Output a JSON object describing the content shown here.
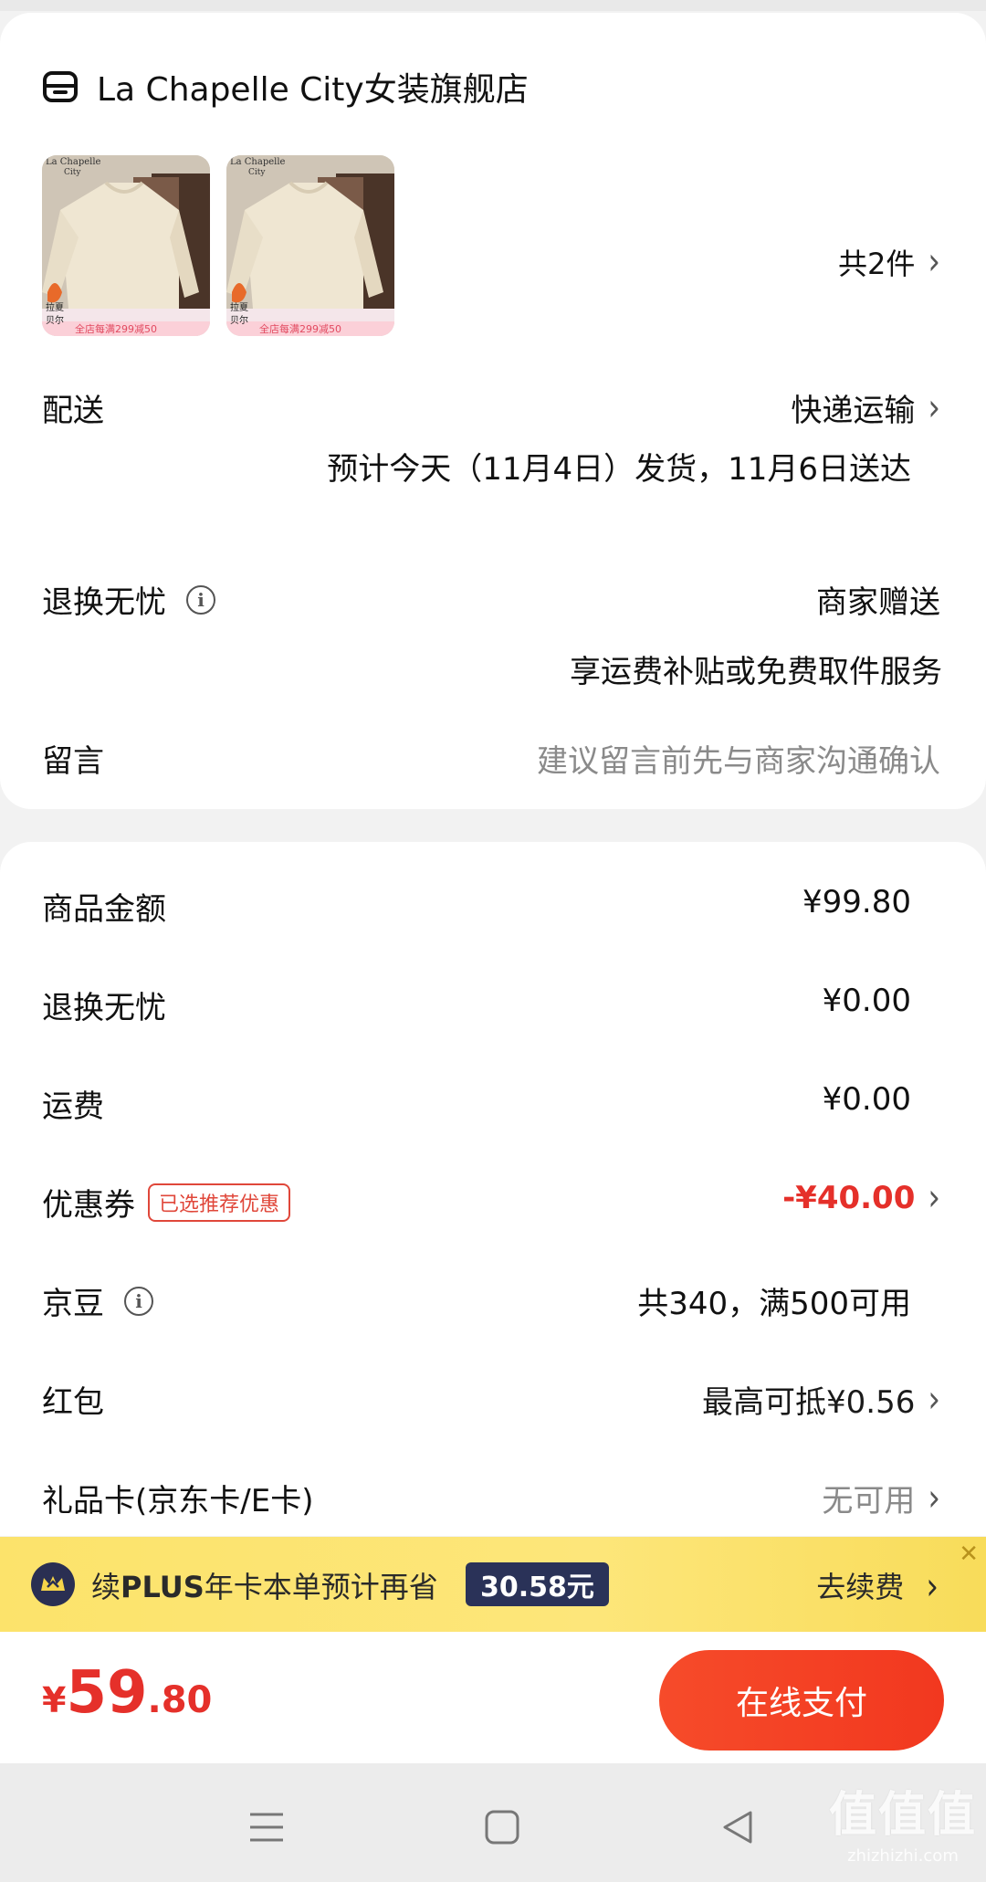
{
  "store": {
    "name": "La Chapelle City女装旗舰店"
  },
  "items": {
    "thumb_text_1": "La Chapelle",
    "thumb_text_2": "City",
    "thumb_promo": "全店每满299减50",
    "thumb_side": "拉夏",
    "thumb_side2": "贝尔",
    "count_label": "共2件"
  },
  "delivery": {
    "label": "配送",
    "method": "快递运输",
    "estimate": "预计今天（11月4日）发货，11月6日送达"
  },
  "returns": {
    "label": "退换无忧",
    "value": "商家赠送",
    "sub": "享运费补贴或免费取件服务"
  },
  "message": {
    "label": "留言",
    "placeholder": "建议留言前先与商家沟通确认"
  },
  "price": {
    "goods_label": "商品金额",
    "goods_value": "¥99.80",
    "returns_label": "退换无忧",
    "returns_value": "¥0.00",
    "shipping_label": "运费",
    "shipping_value": "¥0.00",
    "coupon_label": "优惠券",
    "coupon_tag": "已选推荐优惠",
    "coupon_value": "-¥40.00",
    "beans_label": "京豆",
    "beans_value": "共340，满500可用",
    "redpacket_label": "红包",
    "redpacket_value": "最高可抵¥0.56",
    "giftcard_label": "礼品卡(京东卡/E卡)",
    "giftcard_value": "无可用"
  },
  "plus": {
    "prefix": "续",
    "brand": "PLUS",
    "text": "年卡本单预计再省",
    "saving": "30.58元",
    "action": "去续费",
    "close": "✕"
  },
  "pay": {
    "currency": "¥",
    "amount_int": "59",
    "amount_dec": ".80",
    "button": "在线支付"
  },
  "watermark": {
    "big": "值值值",
    "small": "zhizhizhi.com"
  },
  "colors": {
    "accent": "#e5302a",
    "plus_bg": "#fde67a",
    "plus_dark": "#2a3258"
  }
}
